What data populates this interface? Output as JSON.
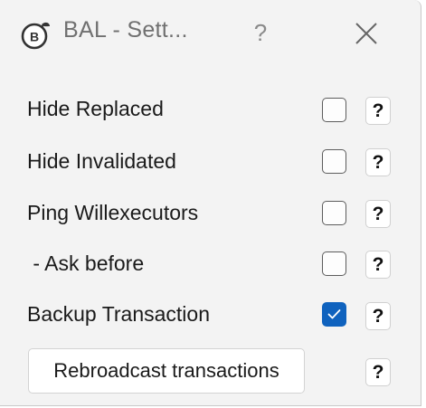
{
  "window": {
    "title": "BAL - Sett...",
    "help_label": "?",
    "close_icon": "close-icon",
    "app_icon": "bal-logo-icon"
  },
  "settings": [
    {
      "label": "Hide Replaced",
      "checked": false,
      "help": "?"
    },
    {
      "label": "Hide Invalidated",
      "checked": false,
      "help": "?"
    },
    {
      "label": "Ping Willexecutors",
      "checked": false,
      "help": "?"
    },
    {
      "label": " - Ask before",
      "checked": false,
      "help": "?"
    },
    {
      "label": "Backup Transaction",
      "checked": true,
      "help": "?"
    }
  ],
  "rebroadcast": {
    "label": "Rebroadcast transactions",
    "help": "?"
  },
  "colors": {
    "checkbox_checked": "#0f62be",
    "window_bg": "#f3f3f3"
  }
}
